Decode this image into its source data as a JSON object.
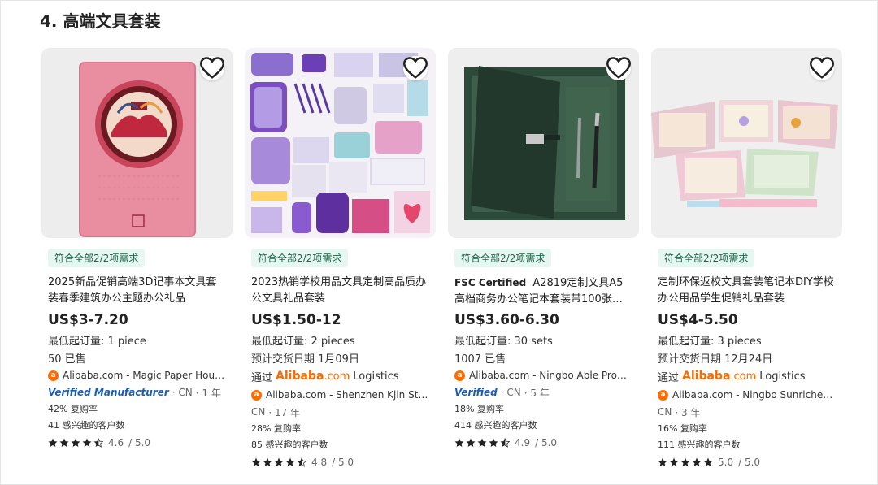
{
  "section": {
    "title": "4. 高端文具套装"
  },
  "products": [
    {
      "tag": "符合全部2/2项需求",
      "title": "2025新品促销高端3D记事本文具套装春季建筑办公主题办公礼品",
      "price": "US$3-7.20",
      "moq": "最低起订量: 1 piece",
      "sold": "50 已售",
      "supplier": "Alibaba.com - Magic Paper House...",
      "verified_label": "Verified Manufacturer",
      "location": "· CN",
      "years": "· 1 年",
      "repurchase": "42% 复购率",
      "interested": "41 感兴趣的客户数",
      "rating": "4.6",
      "rating_max": "/ 5.0"
    },
    {
      "tag": "符合全部2/2项需求",
      "title": "2023热销学校用品文具定制高品质办公文具礼品套装",
      "price": "US$1.50-12",
      "moq": "最低起订量: 2 pieces",
      "delivery": "预计交货日期 1月09日",
      "logistics_prefix": "通过",
      "logistics_brand": "Alibaba",
      "logistics_dotcom": ".com",
      "logistics_suffix": "Logistics",
      "supplier": "Alibaba.com - Shenzhen Kjin Stati...",
      "location": "CN",
      "years": "· 17 年",
      "repurchase": "28% 复购率",
      "interested": "85 感兴趣的客户数",
      "rating": "4.8",
      "rating_max": "/ 5.0"
    },
    {
      "tag": "符合全部2/2项需求",
      "title_prefix": "FSC Certified",
      "title": "A2819定制文具A5高档商务办公笔记本套装带100张日...",
      "price": "US$3.60-6.30",
      "moq": "最低起订量: 30 sets",
      "sold": "1007 已售",
      "supplier": "Alibaba.com - Ningbo Able Promo...",
      "verified_label": "Verified",
      "location": "· CN",
      "years": "· 5 年",
      "repurchase": "18% 复购率",
      "interested": "414 感兴趣的客户数",
      "rating": "4.9",
      "rating_max": "/ 5.0"
    },
    {
      "tag": "符合全部2/2项需求",
      "title": "定制环保返校文具套装笔记本DIY学校办公用品学生促销礼品套装",
      "price": "US$4-5.50",
      "moq": "最低起订量: 3 pieces",
      "delivery": "预计交货日期 12月24日",
      "logistics_prefix": "通过",
      "logistics_brand": "Alibaba",
      "logistics_dotcom": ".com",
      "logistics_suffix": "Logistics",
      "supplier": "Alibaba.com - Ningbo Sunricher I...",
      "location": "CN",
      "years": "· 3 年",
      "repurchase": "16% 复购率",
      "interested": "111 感兴趣的客户数",
      "rating": "5.0",
      "rating_max": "/ 5.0"
    }
  ],
  "icons": {
    "favorite": "heart-outline-icon",
    "supplier_logo": "alibaba-logo-icon",
    "star": "star-icon",
    "half_star": "star-half-icon"
  },
  "colors": {
    "tag_bg": "#e6f7f1",
    "tag_text": "#1f5f47",
    "alibaba_orange": "#ff6a00",
    "verified_blue": "#1a5bb8"
  }
}
